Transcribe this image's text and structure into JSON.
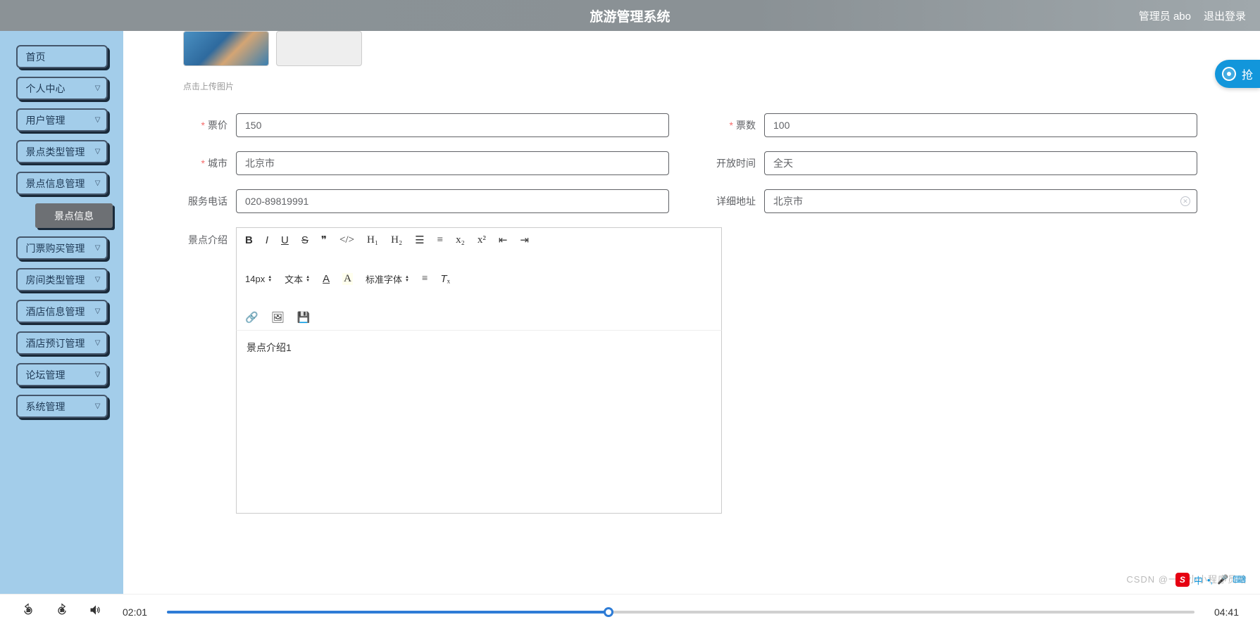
{
  "header": {
    "title": "旅游管理系统",
    "user": "管理员 abo",
    "logout": "退出登录"
  },
  "sidebar": {
    "items": [
      {
        "label": "首页"
      },
      {
        "label": "个人中心"
      },
      {
        "label": "用户管理"
      },
      {
        "label": "景点类型管理"
      },
      {
        "label": "景点信息管理"
      },
      {
        "label": "门票购买管理"
      },
      {
        "label": "房间类型管理"
      },
      {
        "label": "酒店信息管理"
      },
      {
        "label": "酒店预订管理"
      },
      {
        "label": "论坛管理"
      },
      {
        "label": "系统管理"
      }
    ],
    "sub_item": "景点信息"
  },
  "form": {
    "upload_hint": "点击上传图片",
    "price_label": "票价",
    "price_value": "150",
    "qty_label": "票数",
    "qty_value": "100",
    "city_label": "城市",
    "city_value": "北京市",
    "open_label": "开放时间",
    "open_value": "全天",
    "phone_label": "服务电话",
    "phone_value": "020-89819991",
    "addr_label": "详细地址",
    "addr_value": "北京市",
    "intro_label": "景点介绍",
    "intro_value": "景点介绍1"
  },
  "editor": {
    "font_size": "14px",
    "text_label": "文本",
    "font_family": "标准字体"
  },
  "float": {
    "label": "抢"
  },
  "ime": {
    "s": "S",
    "lang": "中"
  },
  "watermark": "CSDN @一枚小小程序员哈",
  "player": {
    "current": "02:01",
    "total": "04:41",
    "progress_pct": 43
  }
}
